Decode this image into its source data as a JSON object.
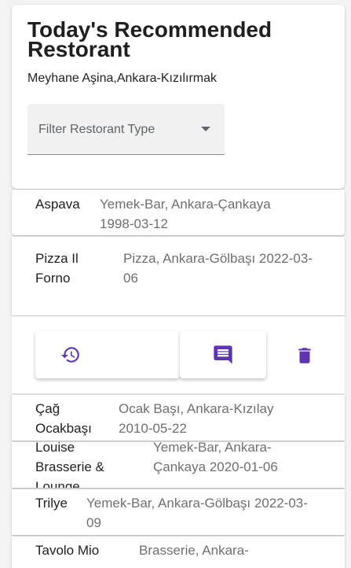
{
  "header": {
    "title": "Today's Recommended Restorant",
    "subtitle": "Meyhane Aşina,Ankara-Kızılırmak",
    "filter_placeholder": "Filter Restorant Type"
  },
  "restaurants": [
    {
      "name": "Aspava",
      "info": "Yemek-Bar, Ankara-Çankaya 1998-03-12"
    },
    {
      "name": "Pizza Il Forno",
      "info": "Pizza, Ankara-Gölbaşı 2022-03-06"
    },
    {
      "name": "Çağ Ocakbaşı",
      "info": "Ocak Başı, Ankara-Kızılay 2010-05-22"
    },
    {
      "name": "Louise Brasserie & Lounge",
      "info": "Yemek-Bar, Ankara-Çankaya 2020-01-06"
    },
    {
      "name": "Trilye",
      "info": "Yemek-Bar, Ankara-Gölbaşı 2022-03-09"
    },
    {
      "name": "Tavolo Mio",
      "info": "Brasserie, Ankara-"
    }
  ],
  "actions": {
    "history_icon": "history-icon",
    "comment_icon": "comment-icon",
    "delete_icon": "delete-icon"
  },
  "colors": {
    "accent": "#5e35b1",
    "background": "#f3f3f4"
  }
}
